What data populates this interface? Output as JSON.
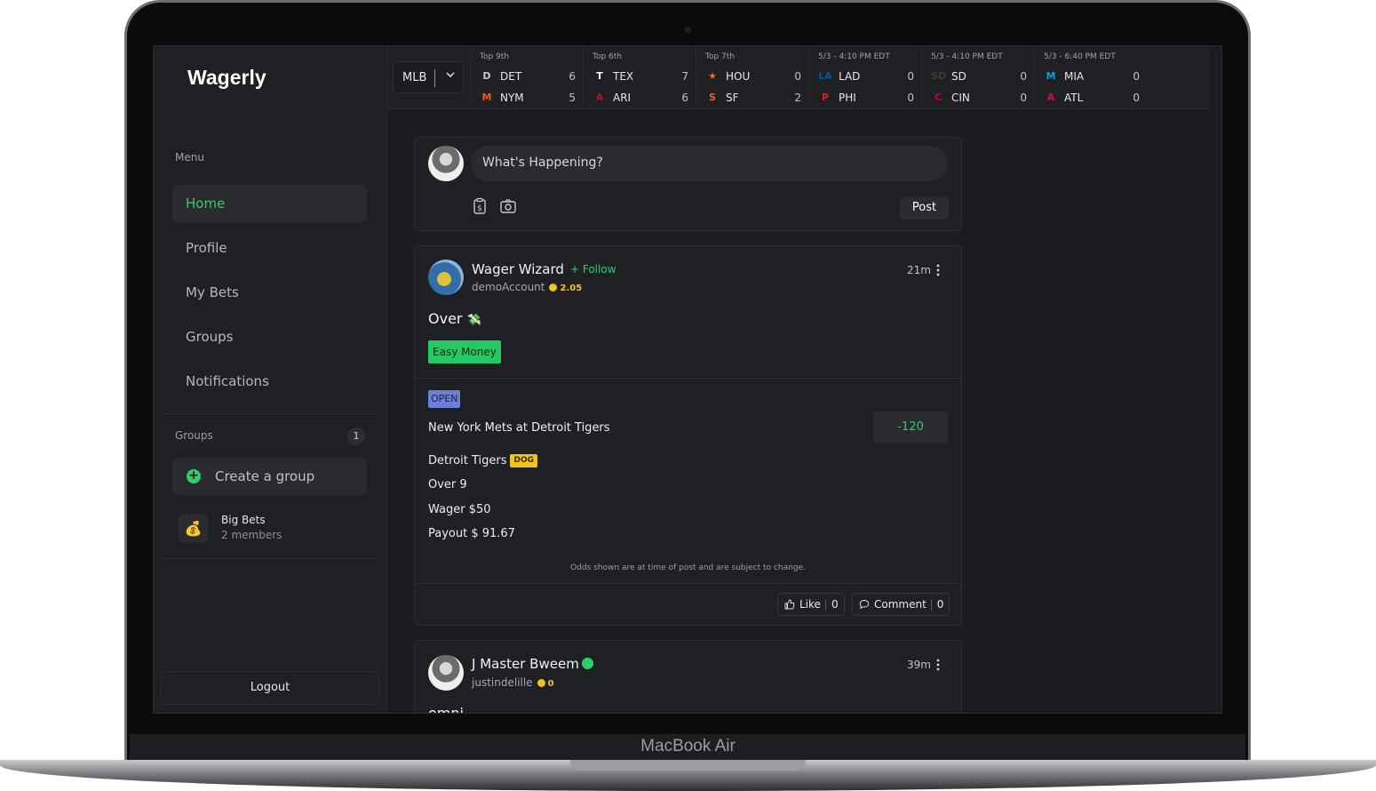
{
  "device": {
    "brand": "MacBook Air"
  },
  "app": {
    "name": "Wagerly"
  },
  "sidebar": {
    "menu_label": "Menu",
    "items": [
      {
        "label": "Home",
        "active": true
      },
      {
        "label": "Profile"
      },
      {
        "label": "My Bets"
      },
      {
        "label": "Groups"
      },
      {
        "label": "Notifications"
      }
    ],
    "groups_label": "Groups",
    "groups_count": "1",
    "create_group_label": "Create a group",
    "group": {
      "name": "Big Bets",
      "members": "2 members",
      "icon": "money-bag-icon"
    },
    "logout_label": "Logout"
  },
  "scoreboard": {
    "league": "MLB",
    "games": [
      {
        "status": "Top 9th",
        "away": {
          "abbr": "DET",
          "score": "6",
          "color": "#c8c9cc"
        },
        "home": {
          "abbr": "NYM",
          "score": "5",
          "color": "#ff5910"
        }
      },
      {
        "status": "Top 6th",
        "away": {
          "abbr": "TEX",
          "score": "7",
          "color": "#ffffff"
        },
        "home": {
          "abbr": "ARI",
          "score": "6",
          "color": "#a71930"
        }
      },
      {
        "status": "Top 7th",
        "away": {
          "abbr": "HOU",
          "score": "0",
          "color": "#eb6e1f"
        },
        "home": {
          "abbr": "SF",
          "score": "2",
          "color": "#fd5a1e"
        }
      },
      {
        "status": "5/3 - 4:10 PM EDT",
        "away": {
          "abbr": "LAD",
          "score": "0",
          "color": "#005a9c"
        },
        "home": {
          "abbr": "PHI",
          "score": "0",
          "color": "#e81828"
        }
      },
      {
        "status": "5/3 - 4:10 PM EDT",
        "away": {
          "abbr": "SD",
          "score": "0",
          "color": "#473729"
        },
        "home": {
          "abbr": "CIN",
          "score": "0",
          "color": "#c6011f"
        }
      },
      {
        "status": "5/3 - 6:40 PM EDT",
        "away": {
          "abbr": "MIA",
          "score": "0",
          "color": "#00a3e0"
        },
        "home": {
          "abbr": "ATL",
          "score": "0",
          "color": "#ce1141"
        }
      }
    ]
  },
  "composer": {
    "placeholder": "What's Happening?",
    "post_label": "Post"
  },
  "posts": [
    {
      "author": "Wager Wizard",
      "follow_label": "+ Follow",
      "handle": "demoAccount",
      "coins": "2.05",
      "time": "21m",
      "text": "Over",
      "emoji": "💸",
      "tag": "Easy Money",
      "bet": {
        "status": "OPEN",
        "matchup": "New York Mets at Detroit Tigers",
        "odds": "-120",
        "pick": "Detroit Tigers",
        "pick_badge": "DOG",
        "line": "Over 9",
        "wager": "Wager $50",
        "payout": "Payout $ 91.67",
        "disclaimer": "Odds shown are at time of post and are subject to change."
      },
      "like_label": "Like",
      "like_count": "0",
      "comment_label": "Comment",
      "comment_count": "0"
    },
    {
      "author": "J Master Bweem",
      "verified": true,
      "handle": "justindelille",
      "coins": "0",
      "time": "39m",
      "text": "omni"
    }
  ],
  "colors": {
    "accent": "#2fce6b",
    "background": "#1b1c1f",
    "panel": "#1f2023",
    "coin": "#f4c21b"
  }
}
